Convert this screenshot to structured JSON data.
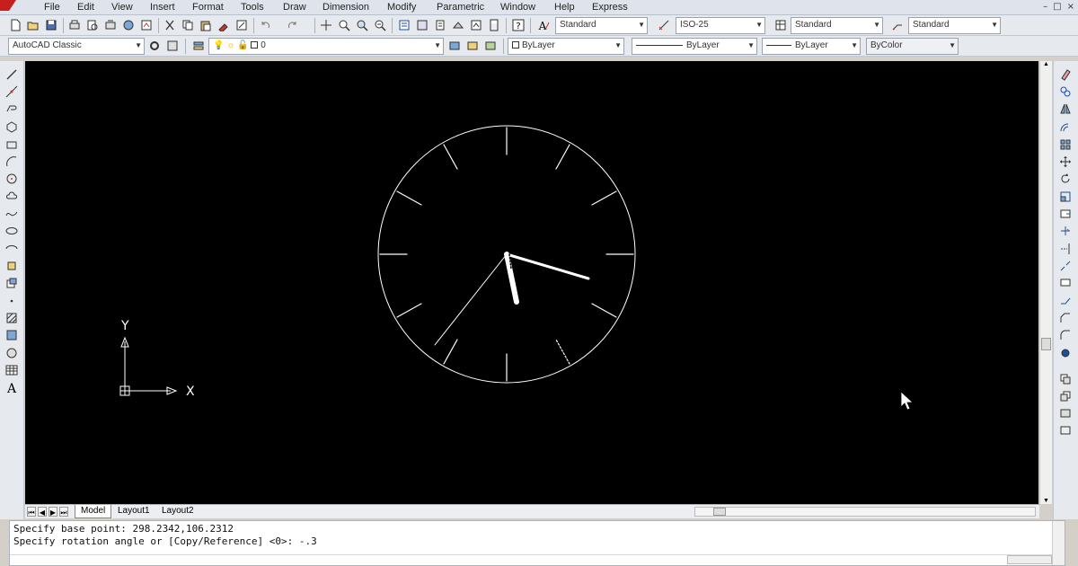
{
  "menubar": {
    "items": [
      "File",
      "Edit",
      "View",
      "Insert",
      "Format",
      "Tools",
      "Draw",
      "Dimension",
      "Modify",
      "Parametric",
      "Window",
      "Help",
      "Express"
    ],
    "window_controls": [
      "–",
      "□",
      "×"
    ]
  },
  "toolbar1": {
    "text_style": "Standard",
    "dim_style": "ISO-25",
    "table_style": "Standard",
    "multileader_style": "Standard"
  },
  "toolbar2": {
    "workspace": "AutoCAD Classic",
    "layer": "0",
    "color": "ByLayer",
    "linetype": "ByLayer",
    "lineweight": "ByLayer",
    "plotstyle": "ByColor"
  },
  "ucs": {
    "x_label": "X",
    "y_label": "Y"
  },
  "tabs": {
    "model": "Model",
    "layout1": "Layout1",
    "layout2": "Layout2"
  },
  "command": {
    "line1": "Specify base point: 298.2342,106.2312",
    "line2": "Specify rotation angle or [Copy/Reference] <0>: -.3"
  },
  "colors": {
    "canvas": "#000000",
    "drawing": "#ffffff",
    "chrome": "#e6e9ee"
  },
  "icons": {
    "left_toolbar": [
      "line-icon",
      "construction-line-icon",
      "polyline-icon",
      "polygon-icon",
      "rectangle-icon",
      "arc-icon",
      "circle-icon",
      "revision-cloud-icon",
      "spline-icon",
      "ellipse-icon",
      "ellipse-arc-icon",
      "insert-block-icon",
      "make-block-icon",
      "point-icon",
      "hatch-icon",
      "gradient-icon",
      "region-icon",
      "table-icon",
      "multiline-text-icon"
    ],
    "right_toolbar": [
      "erase-icon",
      "copy-icon",
      "mirror-icon",
      "offset-icon",
      "array-icon",
      "move-icon",
      "rotate-icon",
      "scale-icon",
      "stretch-icon",
      "trim-icon",
      "extend-icon",
      "break-at-point-icon",
      "break-icon",
      "join-icon",
      "chamfer-icon",
      "fillet-icon",
      "explode-icon",
      "draworder-icon"
    ]
  }
}
